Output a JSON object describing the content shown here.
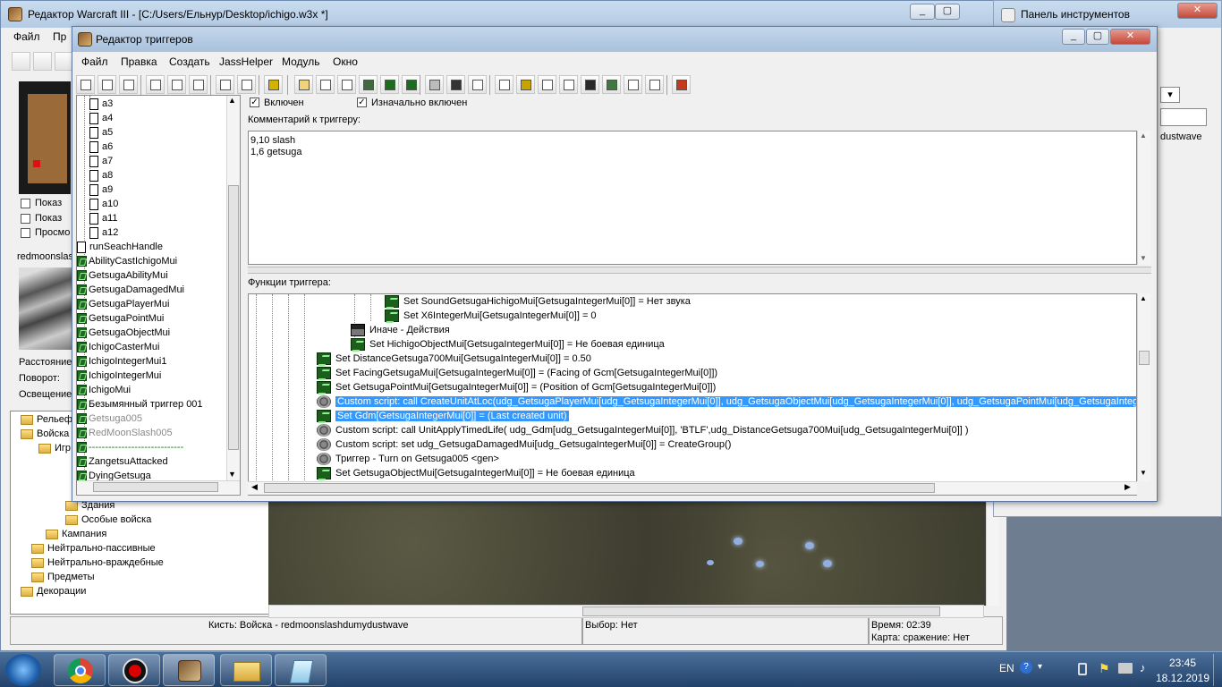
{
  "main": {
    "title": "Редактор Warcraft III  - [C:/Users/Ельнур/Desktop/ichigo.w3x *]",
    "menu": [
      "Файл",
      "Пр"
    ],
    "side_checks": [
      "Показ",
      "Показ",
      "Просмо"
    ],
    "unit_label": "redmoonslas",
    "props": [
      "Расстояние",
      "Поворот:",
      "Освещение"
    ],
    "tree": [
      {
        "label": "Рельеф",
        "indent": 0
      },
      {
        "label": "Войска",
        "indent": 0
      },
      {
        "label": "Игр",
        "indent": 1
      },
      {
        "label": "Здания",
        "indent": 3
      },
      {
        "label": "Особые войска",
        "indent": 3
      },
      {
        "label": "Кампания",
        "indent": 2
      },
      {
        "label": "Нейтрально-пассивные",
        "indent": 1
      },
      {
        "label": "Нейтрально-враждебные",
        "indent": 1
      },
      {
        "label": "Предметы",
        "indent": 1
      },
      {
        "label": "Декорации",
        "indent": 0
      }
    ],
    "status": {
      "brush": "Кисть: Войска - redmoonslashdumydustwave",
      "selection": "Выбор: Нет",
      "time": "Время: 02:39",
      "map": "Карта: сражение: Нет"
    }
  },
  "palette": {
    "title": "Панель инструментов",
    "text": "dustwave"
  },
  "trigger_editor": {
    "title": "Редактор триггеров",
    "menu": [
      "Файл",
      "Правка",
      "Создать",
      "JassHelper",
      "Модуль",
      "Окно"
    ],
    "enabled_label": "Включен",
    "initially_on_label": "Изначально включен",
    "comment_label": "Комментарий к триггеру:",
    "comment_lines": [
      "9,10 slash",
      "1,6 getsuga"
    ],
    "functions_label": "Функции триггера:",
    "tree_items": [
      {
        "label": "a3",
        "type": "doc",
        "indent": 1
      },
      {
        "label": "a4",
        "type": "doc",
        "indent": 1
      },
      {
        "label": "a5",
        "type": "doc",
        "indent": 1
      },
      {
        "label": "a6",
        "type": "doc",
        "indent": 1
      },
      {
        "label": "a7",
        "type": "doc",
        "indent": 1
      },
      {
        "label": "a8",
        "type": "doc",
        "indent": 1
      },
      {
        "label": "a9",
        "type": "doc",
        "indent": 1
      },
      {
        "label": "a10",
        "type": "doc",
        "indent": 1
      },
      {
        "label": "a11",
        "type": "doc",
        "indent": 1
      },
      {
        "label": "a12",
        "type": "doc",
        "indent": 1
      },
      {
        "label": "runSeachHandle",
        "type": "doc",
        "indent": 0
      },
      {
        "label": "AbilityCastIchigoMui",
        "type": "trg",
        "indent": 0
      },
      {
        "label": "GetsugaAbilityMui",
        "type": "trg",
        "indent": 0
      },
      {
        "label": "GetsugaDamagedMui",
        "type": "trg",
        "indent": 0
      },
      {
        "label": "GetsugaPlayerMui",
        "type": "trg",
        "indent": 0
      },
      {
        "label": "GetsugaPointMui",
        "type": "trg",
        "indent": 0
      },
      {
        "label": "GetsugaObjectMui",
        "type": "trg",
        "indent": 0
      },
      {
        "label": "IchigoCasterMui",
        "type": "trg",
        "indent": 0
      },
      {
        "label": "IchigoIntegerMui1",
        "type": "trg",
        "indent": 0
      },
      {
        "label": "IchigoIntegerMui",
        "type": "trg",
        "indent": 0
      },
      {
        "label": "IchigoMui",
        "type": "trg",
        "indent": 0
      },
      {
        "label": "Безымянный триггер 001",
        "type": "trg",
        "indent": 0
      },
      {
        "label": "Getsuga005",
        "type": "trg",
        "indent": 0,
        "disabled": true
      },
      {
        "label": "RedMoonSlash005",
        "type": "trg",
        "indent": 0,
        "disabled": true
      },
      {
        "label": "-----------------------------",
        "type": "sep",
        "indent": 0
      },
      {
        "label": "ZangetsuAttacked",
        "type": "trg",
        "indent": 0
      },
      {
        "label": "DyingGetsuga",
        "type": "trg",
        "indent": 0
      }
    ],
    "functions": [
      {
        "text": "Set SoundGetsugaHichigoMui[GetsugaIntegerMui[0]] = Нет звука",
        "icon": "act",
        "indent": 3
      },
      {
        "text": "Set X6IntegerMui[GetsugaIntegerMui[0]] = 0",
        "icon": "act",
        "indent": 3
      },
      {
        "text": "Иначе - Действия",
        "icon": "clap",
        "indent": 2
      },
      {
        "text": "Set HichigoObjectMui[GetsugaIntegerMui[0]] = Не боевая единица",
        "icon": "act",
        "indent": 2
      },
      {
        "text": "Set DistanceGetsuga700Mui[GetsugaIntegerMui[0]] = 0.50",
        "icon": "act",
        "indent": 1
      },
      {
        "text": "Set FacingGetsugaMui[GetsugaIntegerMui[0]] = (Facing of Gcm[GetsugaIntegerMui[0]])",
        "icon": "act",
        "indent": 1
      },
      {
        "text": "Set GetsugaPointMui[GetsugaIntegerMui[0]] = (Position of Gcm[GetsugaIntegerMui[0]])",
        "icon": "act",
        "indent": 1
      },
      {
        "text": "Custom script:   call CreateUnitAtLoc(udg_GetsugaPlayerMui[udg_GetsugaIntegerMui[0]], udg_GetsugaObjectMui[udg_GetsugaIntegerMui[0]], udg_GetsugaPointMui[udg_GetsugaIntegerMui",
        "icon": "gear",
        "indent": 1,
        "selected": true
      },
      {
        "text": "Set Gdm[GetsugaIntegerMui[0]] = (Last created unit)",
        "icon": "act",
        "indent": 1,
        "selected": true
      },
      {
        "text": "Custom script:   call UnitApplyTimedLife( udg_Gdm[udg_GetsugaIntegerMui[0]], 'BTLF',udg_DistanceGetsuga700Mui[udg_GetsugaIntegerMui[0]]  )",
        "icon": "gear",
        "indent": 1
      },
      {
        "text": "Custom script:   set udg_GetsugaDamagedMui[udg_GetsugaIntegerMui[0]] = CreateGroup()",
        "icon": "gear",
        "indent": 1
      },
      {
        "text": "Триггер - Turn on Getsuga005 <gen>",
        "icon": "gear",
        "indent": 1
      },
      {
        "text": "Set GetsugaObjectMui[GetsugaIntegerMui[0]] = Не боевая единица",
        "icon": "act",
        "indent": 1
      }
    ]
  },
  "taskbar": {
    "lang": "EN",
    "time": "23:45",
    "date": "18.12.2019",
    "apps": [
      "chrome-icon",
      "record-icon",
      "warcraft-editor-icon",
      "explorer-icon",
      "notepad-icon"
    ]
  },
  "colors": {
    "selection": "#3399ff",
    "titlebar": "#b5cbe3",
    "taskbar": "#2a4a70"
  }
}
